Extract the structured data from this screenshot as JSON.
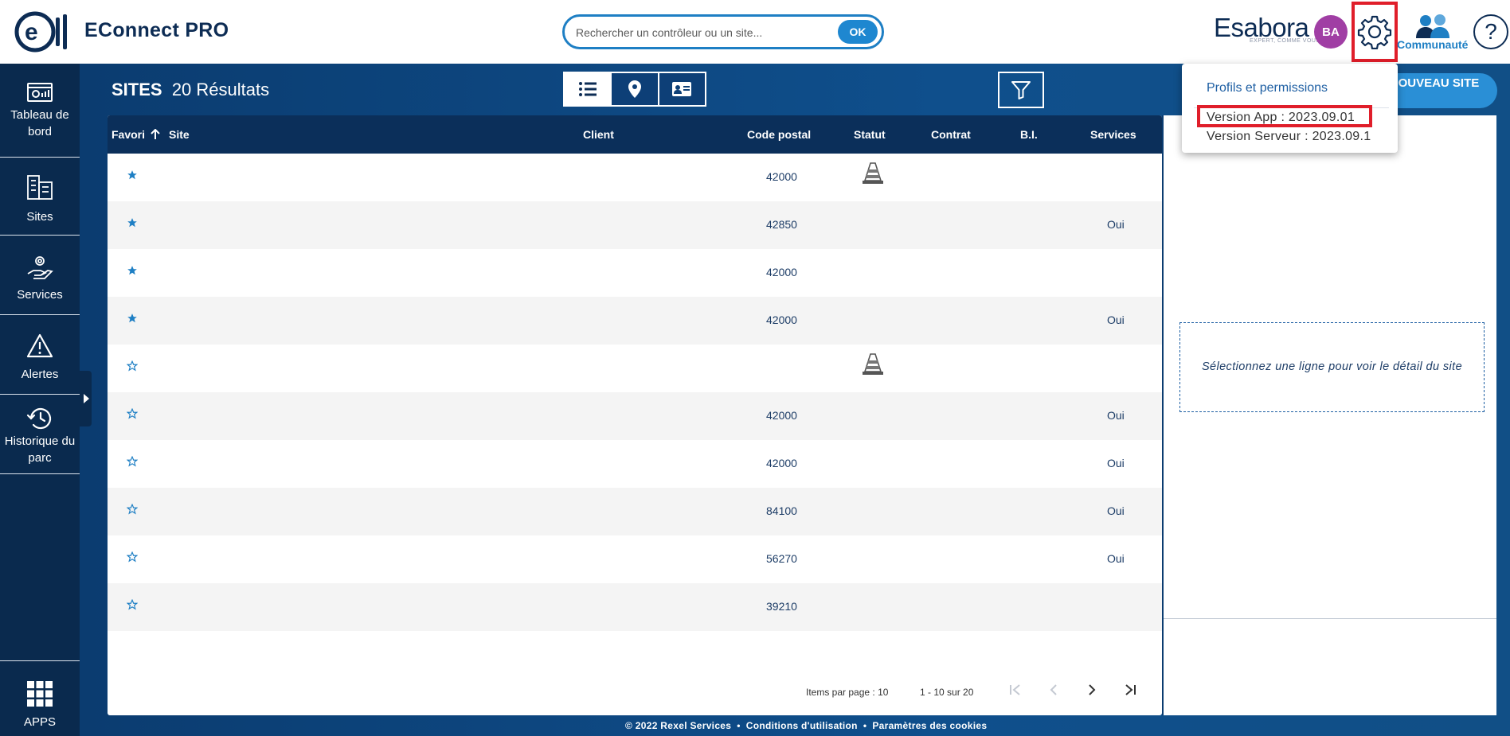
{
  "header": {
    "app_title": "EConnect PRO",
    "search_placeholder": "Rechercher un contrôleur ou un site...",
    "search_button": "OK",
    "brand": "Esabora",
    "brand_tagline": "EXPERT, COMME VOUS",
    "user_initials": "BA",
    "community_label": "Communauté",
    "help_label": "?"
  },
  "sidebar": {
    "items": [
      {
        "label": "Tableau de bord",
        "icon": "dashboard-icon"
      },
      {
        "label": "Sites",
        "icon": "buildings-icon"
      },
      {
        "label": "Services",
        "icon": "services-icon"
      },
      {
        "label": "Alertes",
        "icon": "warning-icon"
      },
      {
        "label": "Historique du parc",
        "icon": "history-icon"
      }
    ],
    "apps_label": "APPS"
  },
  "main": {
    "title_bold": "SITES",
    "result_count": "20 Résultats",
    "new_site_label": "NOUVEAU SITE",
    "view_modes": [
      "list-icon",
      "map-pin-icon",
      "card-icon"
    ],
    "active_view": "list"
  },
  "table": {
    "columns": [
      "Favori",
      "Site",
      "Client",
      "Code postal",
      "Statut",
      "Contrat",
      "B.I.",
      "Services"
    ],
    "sort_column": "Favori",
    "sort_direction": "asc",
    "rows": [
      {
        "favorite": true,
        "postal": "42000",
        "status_icon": "traffic-cone-icon",
        "services": ""
      },
      {
        "favorite": true,
        "postal": "42850",
        "status_icon": "",
        "services": "Oui"
      },
      {
        "favorite": true,
        "postal": "42000",
        "status_icon": "",
        "services": ""
      },
      {
        "favorite": true,
        "postal": "42000",
        "status_icon": "",
        "services": "Oui"
      },
      {
        "favorite": false,
        "postal": "",
        "status_icon": "traffic-cone-icon",
        "services": ""
      },
      {
        "favorite": false,
        "postal": "42000",
        "status_icon": "",
        "services": "Oui"
      },
      {
        "favorite": false,
        "postal": "42000",
        "status_icon": "",
        "services": "Oui"
      },
      {
        "favorite": false,
        "postal": "84100",
        "status_icon": "",
        "services": "Oui"
      },
      {
        "favorite": false,
        "postal": "56270",
        "status_icon": "",
        "services": "Oui"
      },
      {
        "favorite": false,
        "postal": "39210",
        "status_icon": "",
        "services": ""
      }
    ],
    "pagination": {
      "items_per_page_label": "Items par page :",
      "items_per_page": "10",
      "range": "1 - 10 sur 20"
    }
  },
  "detail": {
    "hint": "Sélectionnez une ligne pour voir le détail du site"
  },
  "settings_menu": {
    "profiles": "Profils et permissions",
    "version_app": "Version App : 2023.09.01",
    "version_server": "Version Serveur : 2023.09.1"
  },
  "footer": {
    "copyright": "© 2022 Rexel Services",
    "terms": "Conditions d'utilisation",
    "cookies": "Paramètres des cookies"
  },
  "colors": {
    "navy": "#0d2c54",
    "accent_blue": "#1e87d0",
    "highlight_red": "#e01e2a",
    "avatar_purple": "#a03ea4"
  }
}
